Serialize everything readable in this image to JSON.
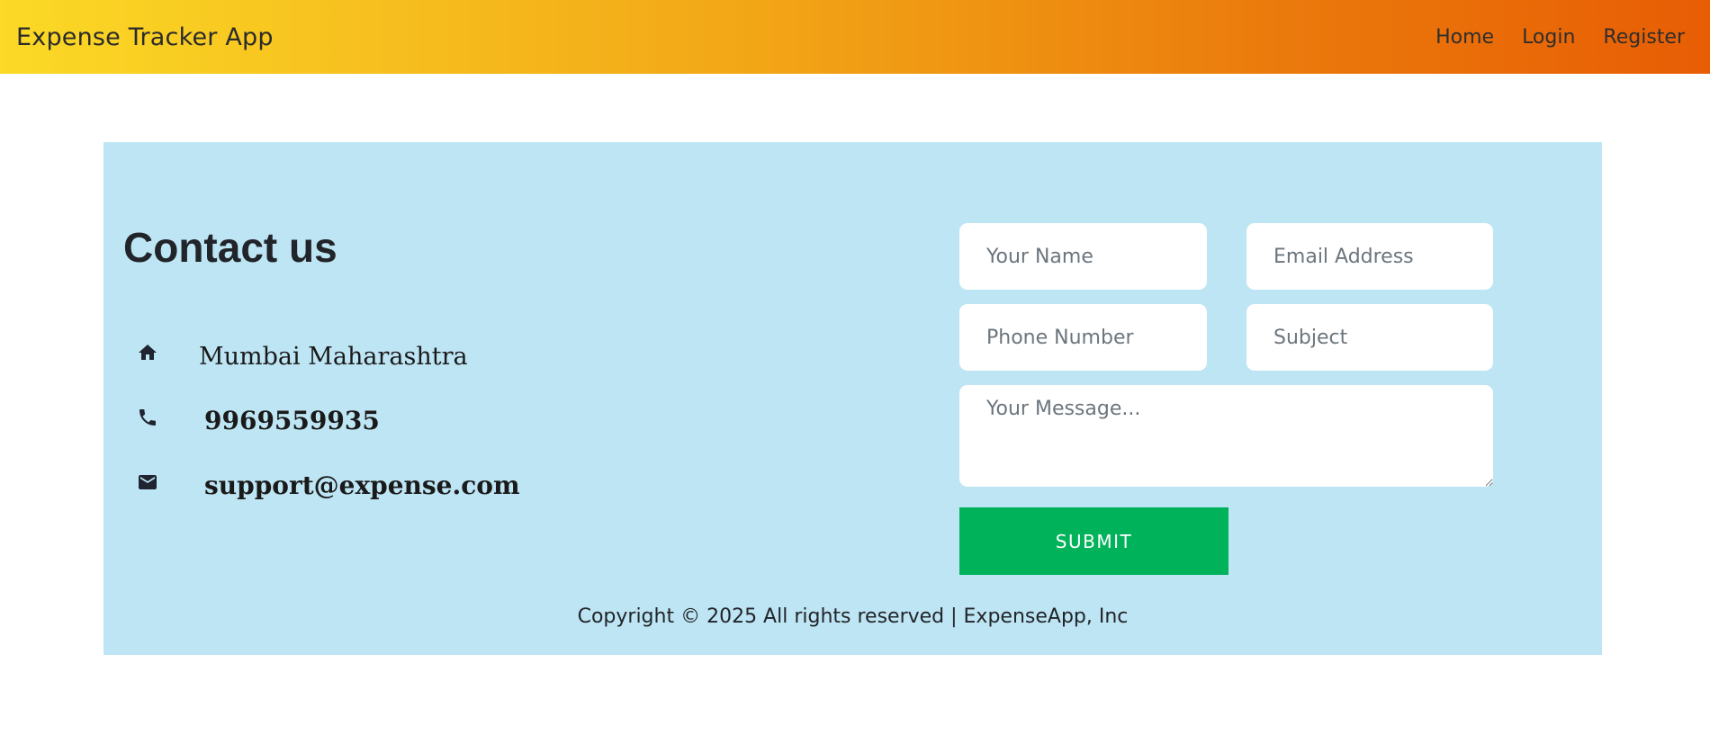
{
  "navbar": {
    "brand": "Expense Tracker App",
    "links": [
      "Home",
      "Login",
      "Register"
    ]
  },
  "contact": {
    "title": "Contact us",
    "address": "Mumbai Maharashtra",
    "phone": "9969559935",
    "email": "support@expense.com",
    "icons": [
      "home-icon",
      "phone-icon",
      "mail-icon"
    ]
  },
  "form": {
    "name_placeholder": "Your Name",
    "email_placeholder": "Email Address",
    "phone_placeholder": "Phone Number",
    "subject_placeholder": "Subject",
    "message_placeholder": "Your Message...",
    "submit_label": "SUBMIT"
  },
  "footer": {
    "copyright": "Copyright © 2025 All rights reserved | ExpenseApp, Inc"
  },
  "colors": {
    "navbar_gradient_start": "#fbd926",
    "navbar_gradient_end": "#e85d04",
    "section_bg": "#bee5f4",
    "submit_bg": "#00b259"
  }
}
